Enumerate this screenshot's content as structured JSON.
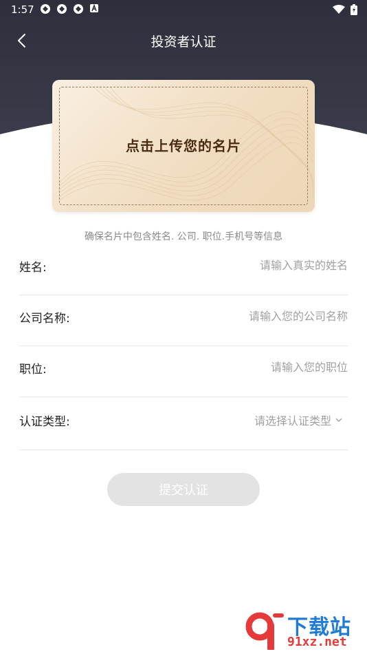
{
  "status_bar": {
    "time": "1:57",
    "icons": [
      "sync-icon",
      "sync-icon",
      "sync-icon",
      "a-badge-icon"
    ],
    "right_icons": [
      "wifi-icon",
      "battery-charging-icon"
    ]
  },
  "app_bar": {
    "title": "投资者认证",
    "back_icon": "chevron-left-icon"
  },
  "card": {
    "upload_text": "点击上传您的名片"
  },
  "hint": "确保名片中包含姓名. 公司. 职位.手机号等信息",
  "form": {
    "name": {
      "label": "姓名:",
      "placeholder": "请输入真实的姓名",
      "value": ""
    },
    "company": {
      "label": "公司名称:",
      "placeholder": "请输入您的公司名称",
      "value": ""
    },
    "position": {
      "label": "职位:",
      "placeholder": "请输入您的职位",
      "value": ""
    },
    "cert_type": {
      "label": "认证类型:",
      "placeholder": "请选择认证类型",
      "icon": "chevron-down-icon"
    }
  },
  "submit_label": "提交认证",
  "watermark": {
    "text": "下载站",
    "url": "91xz.net"
  },
  "colors": {
    "header_bg": "#2e2f3c",
    "card_bg": "#f1ddc1",
    "submit_disabled": "#e3e3e3",
    "watermark_blue": "#1f7bd6",
    "watermark_red": "#e63a3a"
  }
}
